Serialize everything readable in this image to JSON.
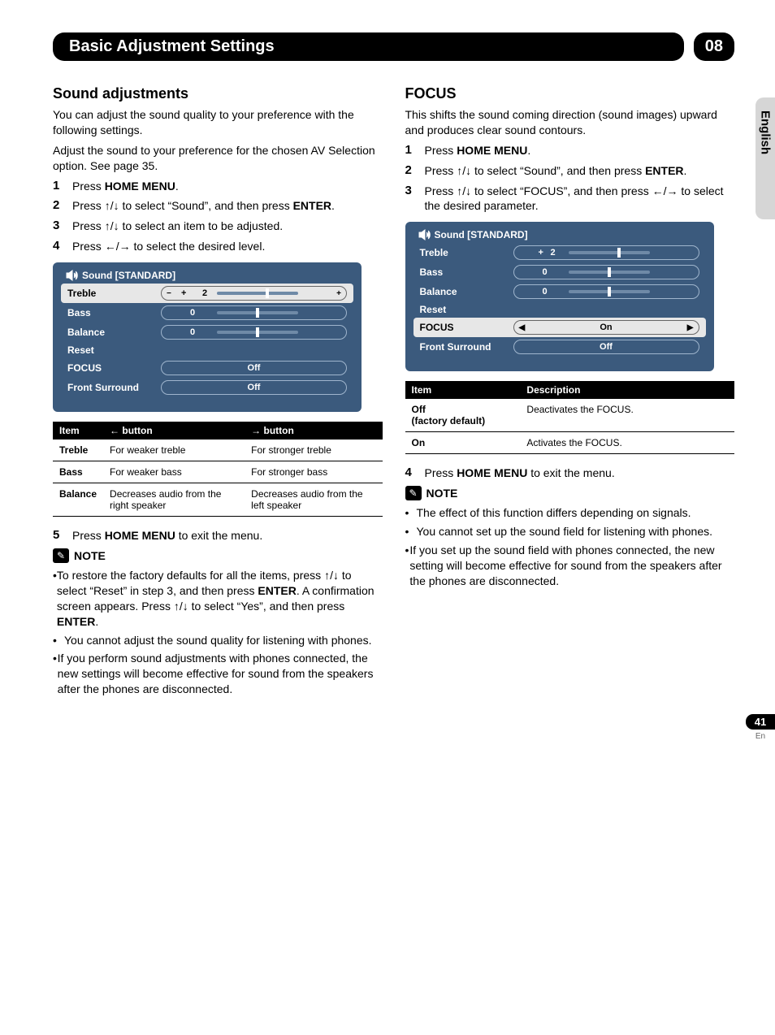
{
  "header": {
    "title": "Basic Adjustment Settings",
    "chapter": "08"
  },
  "sideTab": "English",
  "left": {
    "h": "Sound adjustments",
    "intro1": "You can adjust the sound quality to your preference with the following settings.",
    "intro2": "Adjust the sound to your preference for the chosen AV Selection option. See page 35.",
    "steps": {
      "s1": {
        "n": "1",
        "pre": "Press ",
        "bold": "HOME MENU",
        "post": "."
      },
      "s2": {
        "n": "2",
        "pre": "Press ",
        "arrows": "↑/↓",
        "mid": " to select “Sound”, and then press ",
        "bold": "ENTER",
        "post": "."
      },
      "s3": {
        "n": "3",
        "pre": "Press ",
        "arrows": "↑/↓",
        "post": " to select an item to be adjusted."
      },
      "s4": {
        "n": "4",
        "pre": "Press ",
        "arrows": "←/→",
        "post": " to select the desired level."
      },
      "s5": {
        "n": "5",
        "pre": "Press ",
        "bold": "HOME MENU",
        "post": " to exit the menu."
      }
    },
    "panel": {
      "title": "Sound [STANDARD]",
      "rows": {
        "treble": {
          "label": "Treble",
          "sign": "+",
          "val": "2"
        },
        "bass": {
          "label": "Bass",
          "val": "0"
        },
        "balance": {
          "label": "Balance",
          "val": "0"
        },
        "reset": {
          "label": "Reset"
        },
        "focus": {
          "label": "FOCUS",
          "val": "Off"
        },
        "fs": {
          "label": "Front Surround",
          "val": "Off"
        }
      }
    },
    "table": {
      "h1": "Item",
      "h2": "← button",
      "h3": "→ button",
      "r1": {
        "c1": "Treble",
        "c2": "For weaker treble",
        "c3": "For stronger treble"
      },
      "r2": {
        "c1": "Bass",
        "c2": "For weaker bass",
        "c3": "For stronger bass"
      },
      "r3": {
        "c1": "Balance",
        "c2": "Decreases audio from the right speaker",
        "c3": "Decreases audio from the left speaker"
      }
    },
    "noteLabel": "NOTE",
    "notes": {
      "n1a": "To restore the factory defaults for all the items, press ",
      "n1arrows1": "↑/↓",
      "n1b": " to select “Reset” in step 3, and then press ",
      "n1bold1": "ENTER",
      "n1c": ". A confirmation screen appears. Press ",
      "n1arrows2": "↑/↓",
      "n1d": " to select “Yes”, and then press ",
      "n1bold2": "ENTER",
      "n1e": ".",
      "n2": "You cannot adjust the sound quality for listening with phones.",
      "n3": "If you perform sound adjustments with phones connected, the new settings will become effective for sound from the speakers after the phones are disconnected."
    }
  },
  "right": {
    "h": "FOCUS",
    "intro": "This shifts the sound coming direction (sound images) upward and produces clear sound contours.",
    "steps": {
      "s1": {
        "n": "1",
        "pre": "Press ",
        "bold": "HOME MENU",
        "post": "."
      },
      "s2": {
        "n": "2",
        "pre": "Press ",
        "arrows": "↑/↓",
        "mid": " to select “Sound”, and then press ",
        "bold": "ENTER",
        "post": "."
      },
      "s3": {
        "n": "3",
        "pre": "Press ",
        "arrows1": "↑/↓",
        "mid": " to select “FOCUS”, and then press ",
        "arrows2": "←/→",
        "post": " to select the desired parameter."
      },
      "s4": {
        "n": "4",
        "pre": "Press ",
        "bold": "HOME MENU",
        "post": " to exit the menu."
      }
    },
    "panel": {
      "title": "Sound [STANDARD]",
      "rows": {
        "treble": {
          "label": "Treble",
          "sign": "+",
          "val": "2"
        },
        "bass": {
          "label": "Bass",
          "val": "0"
        },
        "balance": {
          "label": "Balance",
          "val": "0"
        },
        "reset": {
          "label": "Reset"
        },
        "focus": {
          "label": "FOCUS",
          "val": "On"
        },
        "fs": {
          "label": "Front Surround",
          "val": "Off"
        }
      }
    },
    "table": {
      "h1": "Item",
      "h2": "Description",
      "r1": {
        "c1a": "Off",
        "c1b": "(factory default)",
        "c2": "Deactivates the FOCUS."
      },
      "r2": {
        "c1": "On",
        "c2": "Activates the FOCUS."
      }
    },
    "noteLabel": "NOTE",
    "notes": {
      "n1": "The effect of this function differs depending on signals.",
      "n2": "You cannot set up the sound field for listening with phones.",
      "n3": "If you set up the sound field with phones connected, the new setting will become effective for sound from the speakers after the phones are disconnected."
    }
  },
  "footer": {
    "page": "41",
    "lang": "En"
  }
}
